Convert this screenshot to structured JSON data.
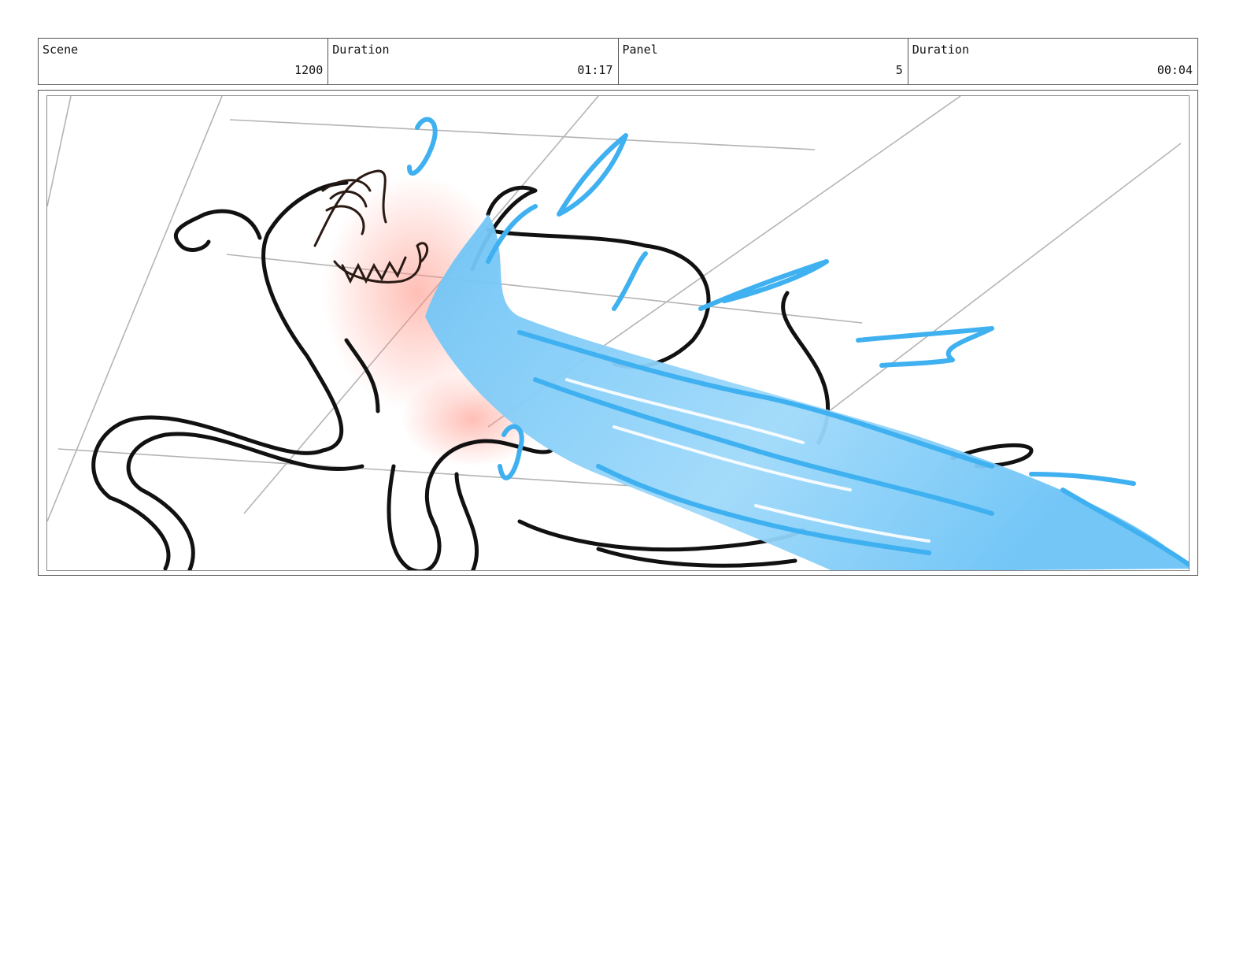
{
  "header": {
    "scene_label": "Scene",
    "scene_value": "1200",
    "scene_duration_label": "Duration",
    "scene_duration_value": "01:17",
    "panel_label": "Panel",
    "panel_value": "5",
    "panel_duration_label": "Duration",
    "panel_duration_value": "00:04"
  },
  "colors": {
    "water": "#3fb0f0",
    "water_light": "#8fd2f8",
    "blush": "#ff9a8a",
    "ink": "#111111",
    "guide": "#a0a0a0"
  }
}
